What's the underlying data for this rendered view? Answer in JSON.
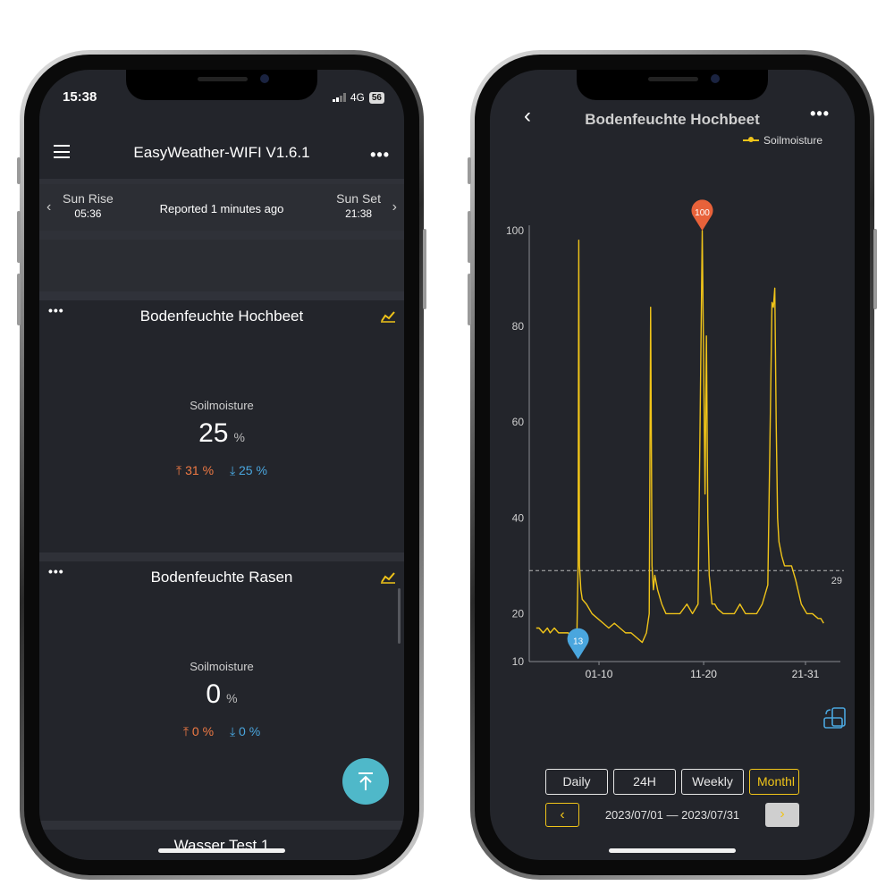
{
  "left": {
    "status": {
      "time": "15:38",
      "network": "4G",
      "battery": "56"
    },
    "appbar": {
      "title": "EasyWeather-WIFI V1.6.1",
      "more": "•••"
    },
    "sun": {
      "rise_label": "Sun Rise",
      "rise_time": "05:36",
      "set_label": "Sun Set",
      "set_time": "21:38",
      "reported": "Reported 1 minutes ago"
    },
    "cards": [
      {
        "title": "Bodenfeuchte Hochbeet",
        "label": "Soilmoisture",
        "value": "25",
        "unit": "%",
        "high": "31 %",
        "low": "25 %"
      },
      {
        "title": "Bodenfeuchte Rasen",
        "label": "Soilmoisture",
        "value": "0",
        "unit": "%",
        "high": "0 %",
        "low": "0 %"
      },
      {
        "title": "Wasser Test 1"
      }
    ],
    "card_more": "•••"
  },
  "right": {
    "back": "‹",
    "title": "Bodenfeuchte Hochbeet",
    "more": "•••",
    "legend": "Soilmoisture",
    "tabs": [
      "Daily",
      "24H",
      "Weekly",
      "Monthl"
    ],
    "active_tab": "Monthl",
    "date_range": "2023/07/01 — 2023/07/31",
    "prev": "‹",
    "next": "›",
    "colors": {
      "line": "#f0c419",
      "max_marker": "#e8623a",
      "min_marker": "#4aa6de"
    }
  },
  "chart_data": {
    "type": "line",
    "title": "Bodenfeuchte Hochbeet",
    "series": [
      {
        "name": "Soilmoisture",
        "color": "#f0c419",
        "x": [
          1,
          1.2,
          1.5,
          1.8,
          2.0,
          2.3,
          2.6,
          3.0,
          3.3,
          3.6,
          3.8,
          3.9,
          4.0,
          4.05,
          4.1,
          4.2,
          4.3,
          4.6,
          5.0,
          5.4,
          5.8,
          6.2,
          6.6,
          7.0,
          7.4,
          7.8,
          8.2,
          8.6,
          8.9,
          9.1,
          9.2,
          9.3,
          9.4,
          9.5,
          9.7,
          10.0,
          10.3,
          10.8,
          11.3,
          11.8,
          12.2,
          12.6,
          12.9,
          13.1,
          13.2,
          13.3,
          13.4,
          13.5,
          13.6,
          13.7,
          13.8,
          14.0,
          14.4,
          14.8,
          15.2,
          15.6,
          16.0,
          16.4,
          16.8,
          17.2,
          17.6,
          17.9,
          18.0,
          18.1,
          18.2,
          18.3,
          18.4,
          18.6,
          18.8,
          19.0,
          19.3,
          19.6,
          20.0,
          20.4,
          20.8,
          21.2,
          21.4,
          21.6
        ],
        "values": [
          17,
          17,
          16,
          17,
          16,
          17,
          16,
          16,
          16,
          14,
          13,
          13,
          30,
          98,
          30,
          25,
          23,
          22,
          20,
          19,
          18,
          17,
          18,
          17,
          16,
          16,
          15,
          14,
          16,
          20,
          84,
          30,
          25,
          28,
          25,
          22,
          20,
          20,
          20,
          22,
          20,
          22,
          100,
          45,
          78,
          40,
          28,
          25,
          22,
          22,
          22,
          21,
          20,
          20,
          20,
          22,
          20,
          20,
          20,
          22,
          26,
          85,
          84,
          88,
          60,
          40,
          35,
          32,
          30,
          30,
          30,
          27,
          22,
          20,
          20,
          19,
          19,
          18
        ]
      }
    ],
    "x_ticks": [
      "01-10",
      "11-20",
      "21-31"
    ],
    "y_ticks": [
      10,
      20,
      40,
      60,
      80,
      100
    ],
    "ylim": [
      10,
      100
    ],
    "reference_line": 29,
    "max_marker": 100,
    "min_marker": 13,
    "grid": false
  }
}
